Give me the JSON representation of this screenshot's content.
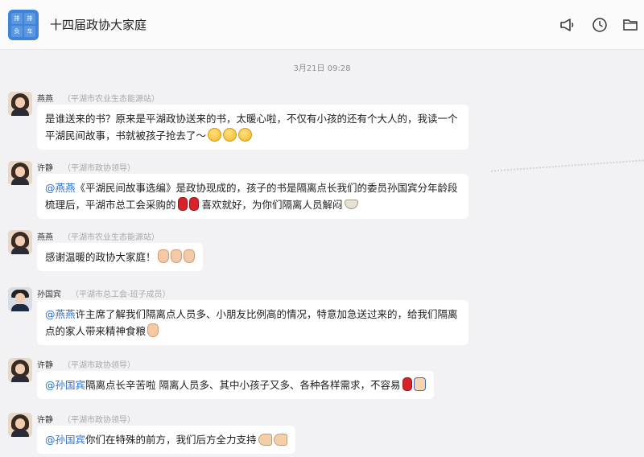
{
  "header": {
    "app_logo_chars": [
      "排",
      "排",
      "负",
      "车"
    ],
    "title": "十四届政协大家庭"
  },
  "icons": {
    "announce": "megaphone-icon",
    "history": "clock-icon",
    "files": "folder-icon"
  },
  "timestamp": "3月21日 09:28",
  "messages": [
    {
      "sender": "燕燕",
      "org": "（平湖市农业生态能源站）",
      "text": "是谁送来的书？原来是平湖政协送来的书，太暖心啦，不仅有小孩的还有个大人的，我读一个平湖民间故事，书就被孩子抢去了～"
    },
    {
      "sender": "许静",
      "org": "（平湖市政协领导）",
      "mention": "@燕燕",
      "text_a": "《平湖民间故事选编》是政协现成的，孩子的书是隔离点长我们的委员孙国宾分年龄段梳理后，平湖市总工会采购的",
      "text_b": "喜欢就好，为你们隔离人员解闷"
    },
    {
      "sender": "燕燕",
      "org": "（平湖市农业生态能源站）",
      "text": "感谢温暖的政协大家庭！"
    },
    {
      "sender": "孙国宾",
      "org": "（平湖市总工会-班子成员）",
      "mention": "@燕燕",
      "text": "许主席了解我们隔离点人员多、小朋友比例高的情况，特意加急送过来的，给我们隔离点的家人带来精神食粮"
    },
    {
      "sender": "许静",
      "org": "（平湖市政协领导）",
      "mention": "@孙国宾",
      "text": "隔离点长辛苦啦 隔离人员多、其中小孩子又多、各种各样需求，不容易"
    },
    {
      "sender": "许静",
      "org": "（平湖市政协领导）",
      "mention": "@孙国宾",
      "text": "你们在特殊的前方，我们后方全力支持"
    }
  ]
}
